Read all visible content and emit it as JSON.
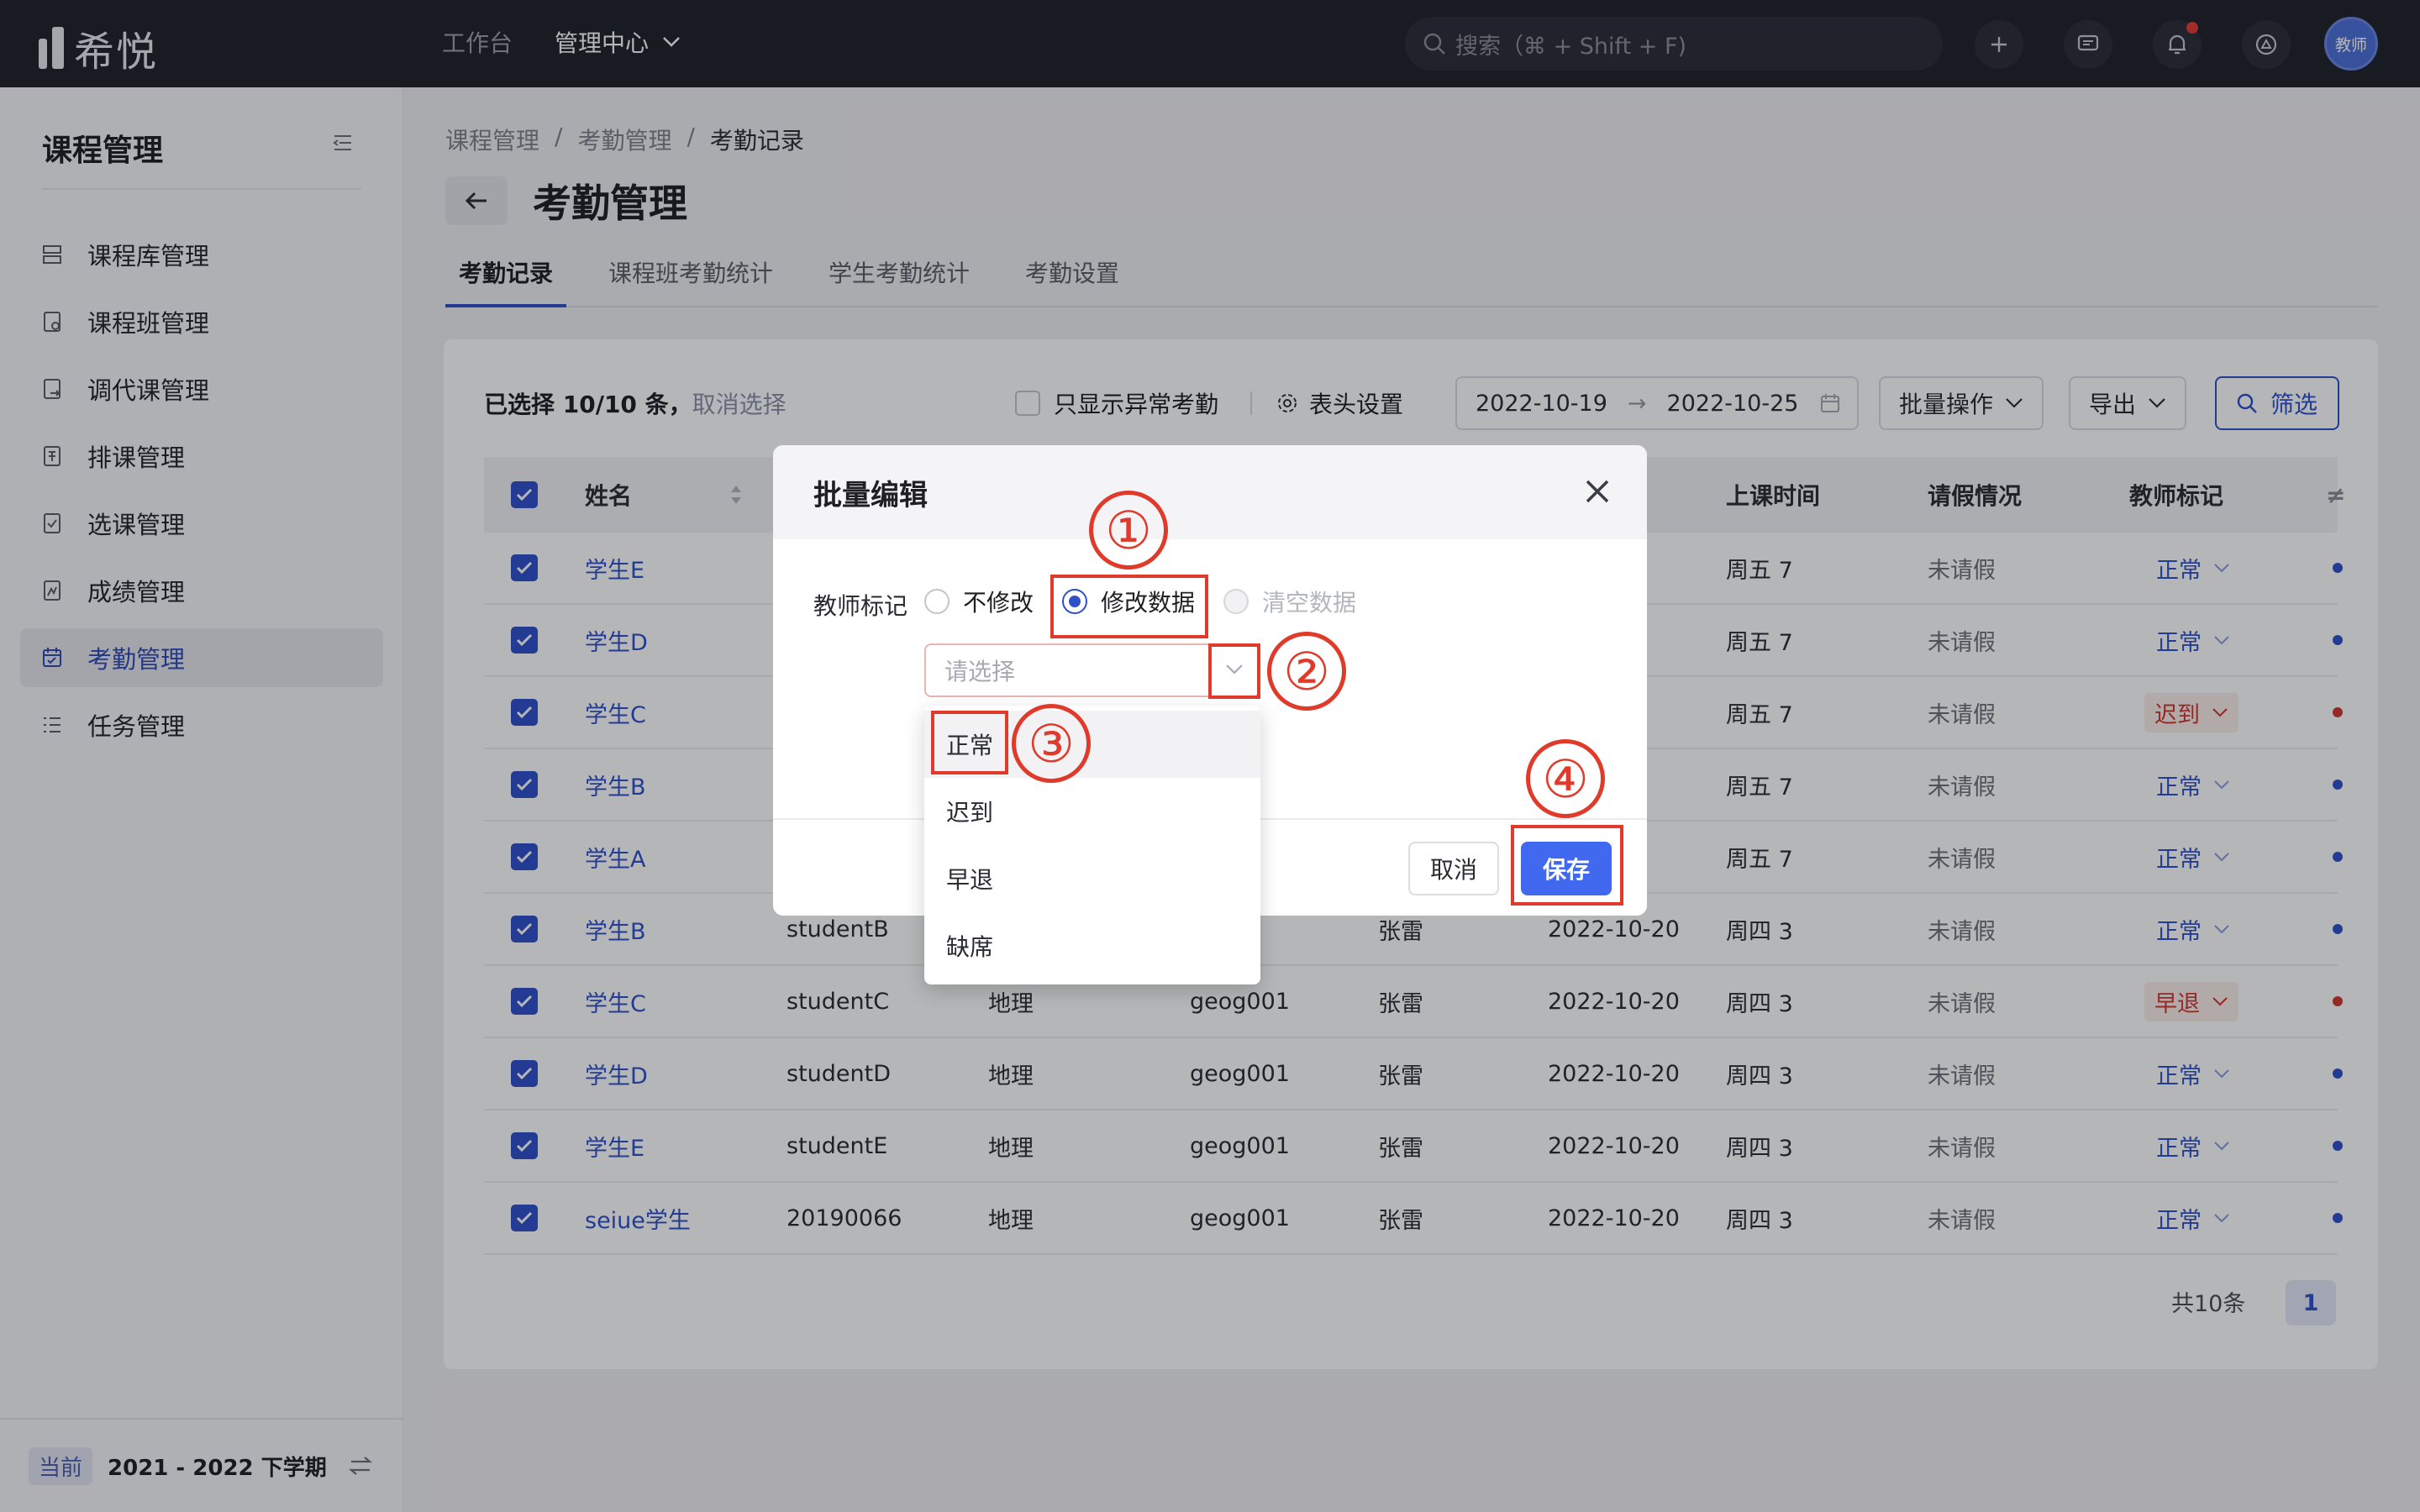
{
  "app": {
    "logo_text": "希悦",
    "avatar": "教师"
  },
  "topnav": {
    "workbench": "工作台",
    "admin": "管理中心"
  },
  "search": {
    "placeholder": "搜索（⌘ + Shift + F)"
  },
  "sidebar": {
    "title": "课程管理",
    "items": [
      {
        "label": "课程库管理",
        "icon": "stack-icon"
      },
      {
        "label": "课程班管理",
        "icon": "class-doc-icon"
      },
      {
        "label": "调代课管理",
        "icon": "swap-doc-icon"
      },
      {
        "label": "排课管理",
        "icon": "schedule-icon"
      },
      {
        "label": "选课管理",
        "icon": "checklist-icon"
      },
      {
        "label": "成绩管理",
        "icon": "grade-icon"
      },
      {
        "label": "考勤管理",
        "icon": "calendar-icon"
      },
      {
        "label": "任务管理",
        "icon": "task-list-icon"
      }
    ],
    "footer": {
      "badge": "当前",
      "term": "2021 - 2022 下学期"
    }
  },
  "breadcrumb": [
    "课程管理",
    "考勤管理",
    "考勤记录"
  ],
  "page_title": "考勤管理",
  "tabs": [
    "考勤记录",
    "课程班考勤统计",
    "学生考勤统计",
    "考勤设置"
  ],
  "toolbar": {
    "selected": "已选择 10/10 条，",
    "cancel_select": "取消选择",
    "only_abnormal": "只显示异常考勤",
    "column_settings": "表头设置",
    "date_start": "2022-10-19",
    "date_arrow": "→",
    "date_end": "2022-10-25",
    "batch": "批量操作",
    "export": "导出",
    "filter": "筛选"
  },
  "table": {
    "headers": {
      "name": "姓名",
      "class_time": "上课时间",
      "leave": "请假情况",
      "teacher_mark": "教师标记"
    },
    "rows": [
      {
        "name": "学生E",
        "id": "",
        "subject": "",
        "course": "",
        "teacher": "",
        "date": "",
        "time": "周五 7",
        "leave": "未请假",
        "mark": "正常",
        "mark_type": "normal"
      },
      {
        "name": "学生D",
        "id": "",
        "subject": "",
        "course": "",
        "teacher": "",
        "date": "",
        "time": "周五 7",
        "leave": "未请假",
        "mark": "正常",
        "mark_type": "normal"
      },
      {
        "name": "学生C",
        "id": "",
        "subject": "",
        "course": "",
        "teacher": "",
        "date": "",
        "time": "周五 7",
        "leave": "未请假",
        "mark": "迟到",
        "mark_type": "late"
      },
      {
        "name": "学生B",
        "id": "",
        "subject": "",
        "course": "",
        "teacher": "",
        "date": "",
        "time": "周五 7",
        "leave": "未请假",
        "mark": "正常",
        "mark_type": "normal"
      },
      {
        "name": "学生A",
        "id": "",
        "subject": "",
        "course": "",
        "teacher": "",
        "date": "",
        "time": "周五 7",
        "leave": "未请假",
        "mark": "正常",
        "mark_type": "normal"
      },
      {
        "name": "学生B",
        "id": "studentB",
        "subject": "",
        "course": "01",
        "teacher": "张雷",
        "date": "2022-10-20",
        "time": "周四 3",
        "leave": "未请假",
        "mark": "正常",
        "mark_type": "normal"
      },
      {
        "name": "学生C",
        "id": "studentC",
        "subject": "地理",
        "course": "geog001",
        "teacher": "张雷",
        "date": "2022-10-20",
        "time": "周四 3",
        "leave": "未请假",
        "mark": "早退",
        "mark_type": "early"
      },
      {
        "name": "学生D",
        "id": "studentD",
        "subject": "地理",
        "course": "geog001",
        "teacher": "张雷",
        "date": "2022-10-20",
        "time": "周四 3",
        "leave": "未请假",
        "mark": "正常",
        "mark_type": "normal"
      },
      {
        "name": "学生E",
        "id": "studentE",
        "subject": "地理",
        "course": "geog001",
        "teacher": "张雷",
        "date": "2022-10-20",
        "time": "周四 3",
        "leave": "未请假",
        "mark": "正常",
        "mark_type": "normal"
      },
      {
        "name": "seiue学生",
        "id": "20190066",
        "subject": "地理",
        "course": "geog001",
        "teacher": "张雷",
        "date": "2022-10-20",
        "time": "周四 3",
        "leave": "未请假",
        "mark": "正常",
        "mark_type": "normal"
      }
    ]
  },
  "pager": {
    "total": "共10条",
    "page": "1"
  },
  "modal": {
    "title": "批量编辑",
    "field_label": "教师标记",
    "radio_options": [
      "不修改",
      "修改数据",
      "清空数据"
    ],
    "selected_radio": "修改数据",
    "select_placeholder": "请选择",
    "cancel": "取消",
    "save": "保存"
  },
  "dropdown": {
    "options": [
      "正常",
      "迟到",
      "早退",
      "缺席"
    ],
    "hovered": "正常"
  },
  "annotations": [
    "①",
    "②",
    "③",
    "④"
  ],
  "colors": {
    "primary": "#2f50c9",
    "save_button": "#4169f0",
    "annotation": "#e03a2a",
    "topbar": "#20212a",
    "abnormal": "#d2362e"
  }
}
